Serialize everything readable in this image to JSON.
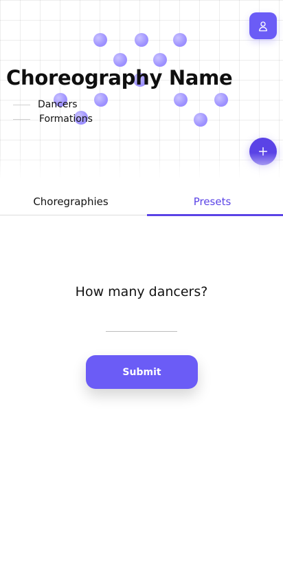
{
  "hero": {
    "title": "Choreography Name",
    "legend": {
      "dancers_label": "Dancers",
      "formations_label": "Formations"
    }
  },
  "actions": {
    "user_icon": "user-icon",
    "add_icon": "plus-icon"
  },
  "tabs": [
    {
      "label": "Choregraphies",
      "active": false
    },
    {
      "label": "Presets",
      "active": true
    }
  ],
  "form": {
    "question": "How many dancers?",
    "input_value": "",
    "submit_label": "Submit"
  },
  "colors": {
    "accent": "#6b5cf6",
    "accent_dark": "#5a43e6",
    "dancer": "#9f93ff"
  }
}
